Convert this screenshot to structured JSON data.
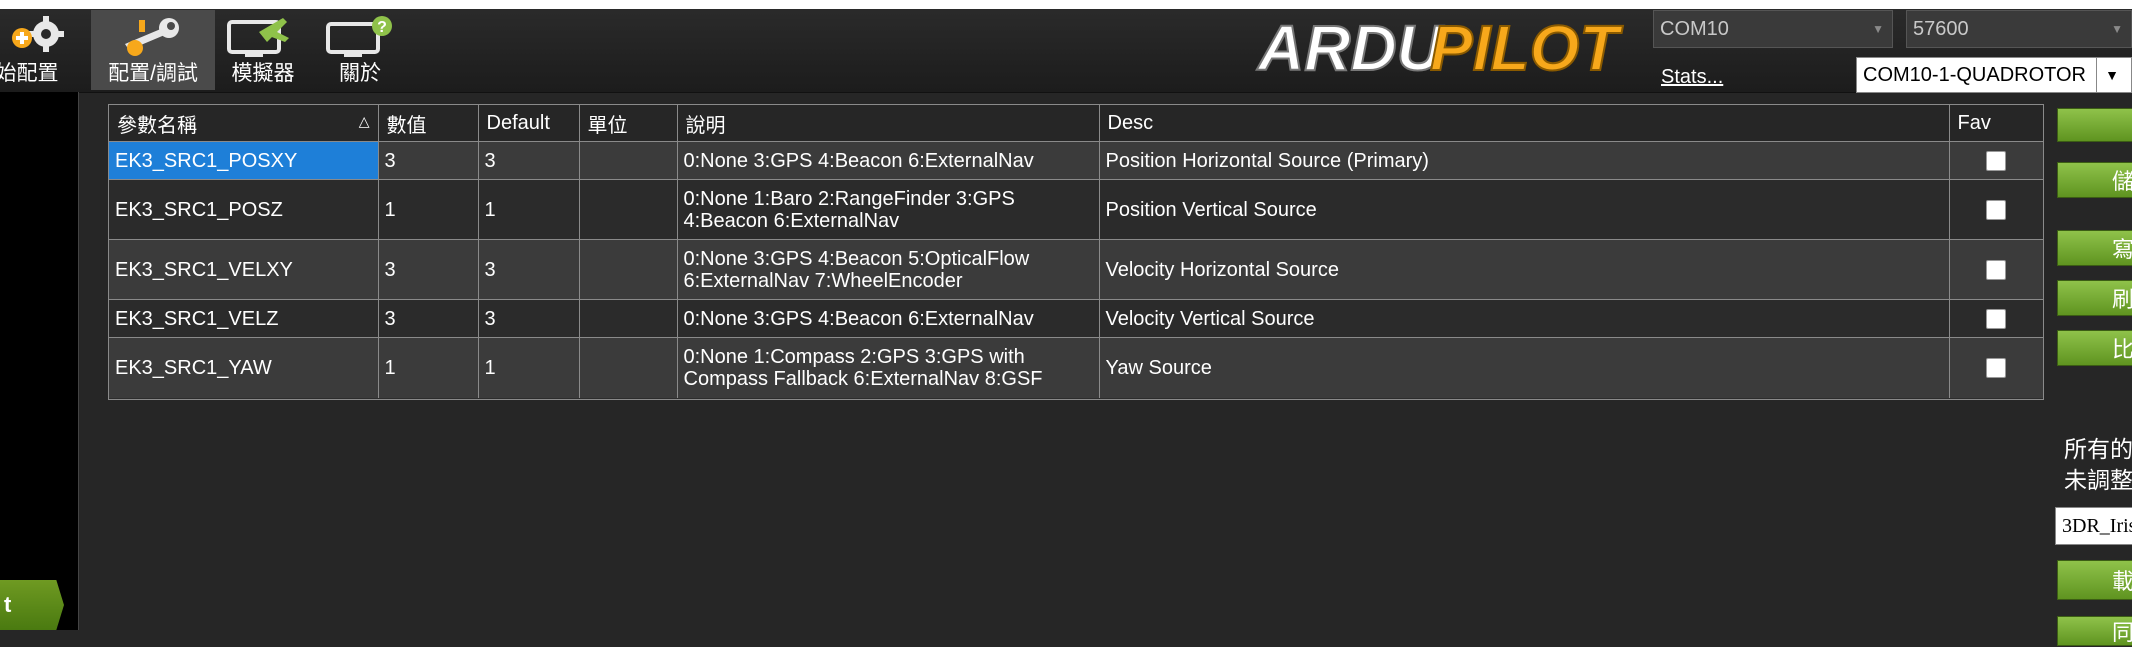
{
  "toolbar": {
    "items": [
      {
        "label": "始配置",
        "icon": "gear-plus-icon"
      },
      {
        "label": "配置/調試",
        "icon": "wrench-icon"
      },
      {
        "label": "模擬器",
        "icon": "monitor-plane-icon"
      },
      {
        "label": "關於",
        "icon": "monitor-help-icon"
      }
    ],
    "active_index": 1
  },
  "logo": {
    "part1": "ARDU",
    "part2": "PILOT"
  },
  "connection": {
    "port": "COM10",
    "baud": "57600",
    "stats_label": "Stats...",
    "link": "COM10-1-QUADROTOR"
  },
  "sidebar": {
    "tab_label": "t"
  },
  "grid": {
    "headers": {
      "name": "參數名稱",
      "value": "數值",
      "default": "Default",
      "units": "單位",
      "options": "說明",
      "desc": "Desc",
      "fav": "Fav"
    },
    "sort_glyph": "△",
    "rows": [
      {
        "name": "EK3_SRC1_POSXY",
        "value": "3",
        "default": "3",
        "units": "",
        "options": "0:None 3:GPS 4:Beacon 6:ExternalNav",
        "desc": "Position Horizontal Source (Primary)",
        "fav": false
      },
      {
        "name": "EK3_SRC1_POSZ",
        "value": "1",
        "default": "1",
        "units": "",
        "options": "0:None 1:Baro 2:RangeFinder 3:GPS 4:Beacon 6:ExternalNav",
        "desc": "Position Vertical Source",
        "fav": false
      },
      {
        "name": "EK3_SRC1_VELXY",
        "value": "3",
        "default": "3",
        "units": "",
        "options": "0:None 3:GPS 4:Beacon 5:OpticalFlow 6:ExternalNav 7:WheelEncoder",
        "desc": "Velocity Horizontal Source",
        "fav": false
      },
      {
        "name": "EK3_SRC1_VELZ",
        "value": "3",
        "default": "3",
        "units": "",
        "options": "0:None 3:GPS 4:Beacon 6:ExternalNav",
        "desc": "Velocity Vertical Source",
        "fav": false
      },
      {
        "name": "EK3_SRC1_YAW",
        "value": "1",
        "default": "1",
        "units": "",
        "options": "0:None 1:Compass 2:GPS 3:GPS with Compass Fallback 6:ExternalNav 8:GSF",
        "desc": "Yaw Source",
        "fav": false
      }
    ]
  },
  "right_panel": {
    "buttons": [
      "",
      "儲",
      "寫",
      "刷",
      "比",
      "載",
      "同"
    ],
    "text_line1": "所有的",
    "text_line2": "未調整",
    "config_value": "3DR_Iris"
  },
  "colors": {
    "selection": "#1e7fd8",
    "button_green": "#7ab33a",
    "logo_orange": "#f7a81b"
  }
}
